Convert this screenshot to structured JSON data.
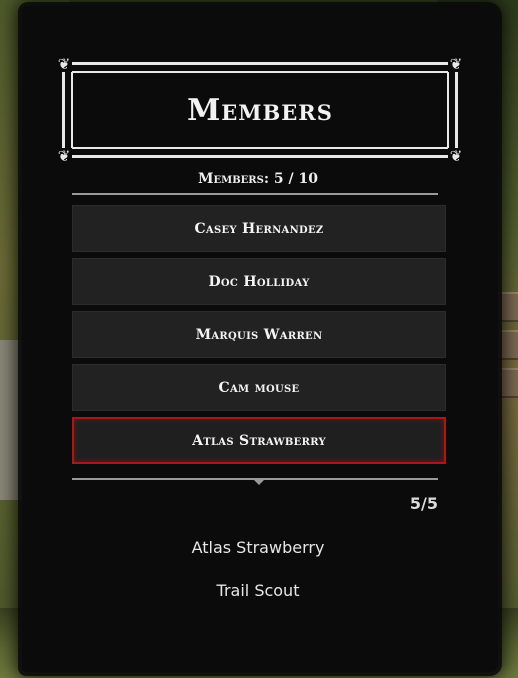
{
  "title": "Members",
  "members_count_label": "Members: 5 / 10",
  "members": [
    {
      "name": "Casey Hernandez",
      "selected": false
    },
    {
      "name": "Doc Holliday",
      "selected": false
    },
    {
      "name": "Marquis Warren",
      "selected": false
    },
    {
      "name": "Cam mouse",
      "selected": false
    },
    {
      "name": "Atlas Strawberry",
      "selected": true
    }
  ],
  "pager": "5/5",
  "selected_detail": {
    "name": "Atlas Strawberry",
    "role": "Trail Scout"
  },
  "colors": {
    "panel": "#0b0b0b",
    "row": "#222222",
    "selected_border": "#a81818",
    "text": "#f4f4f4"
  }
}
